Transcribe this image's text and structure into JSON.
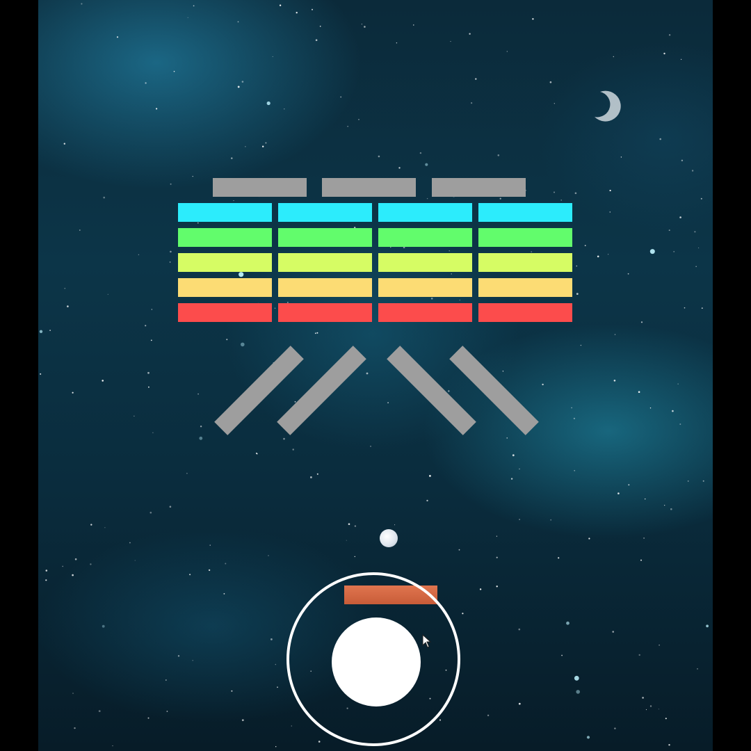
{
  "game": "brick-breaker",
  "colors": {
    "gray_brick": "#9e9e9e",
    "row_cyan": "#2cecfc",
    "row_green": "#62fc6c",
    "row_lime": "#d6fc64",
    "row_yellow": "#fcdc74",
    "row_red": "#fc4c4c",
    "paddle": "#d4653f",
    "ball": "#e8eef4",
    "joystick": "#ffffff"
  },
  "bricks": {
    "top_gray_count": 3,
    "rows": [
      "cyan",
      "green",
      "lime",
      "yellow",
      "red"
    ],
    "columns_per_row": 4
  },
  "bumpers": [
    {
      "orientation": "slash"
    },
    {
      "orientation": "slash"
    },
    {
      "orientation": "backslash"
    },
    {
      "orientation": "backslash"
    }
  ],
  "icons": {
    "ball": "ball-icon",
    "paddle": "paddle-icon",
    "joystick": "joystick-icon",
    "cursor": "mouse-cursor-icon"
  }
}
